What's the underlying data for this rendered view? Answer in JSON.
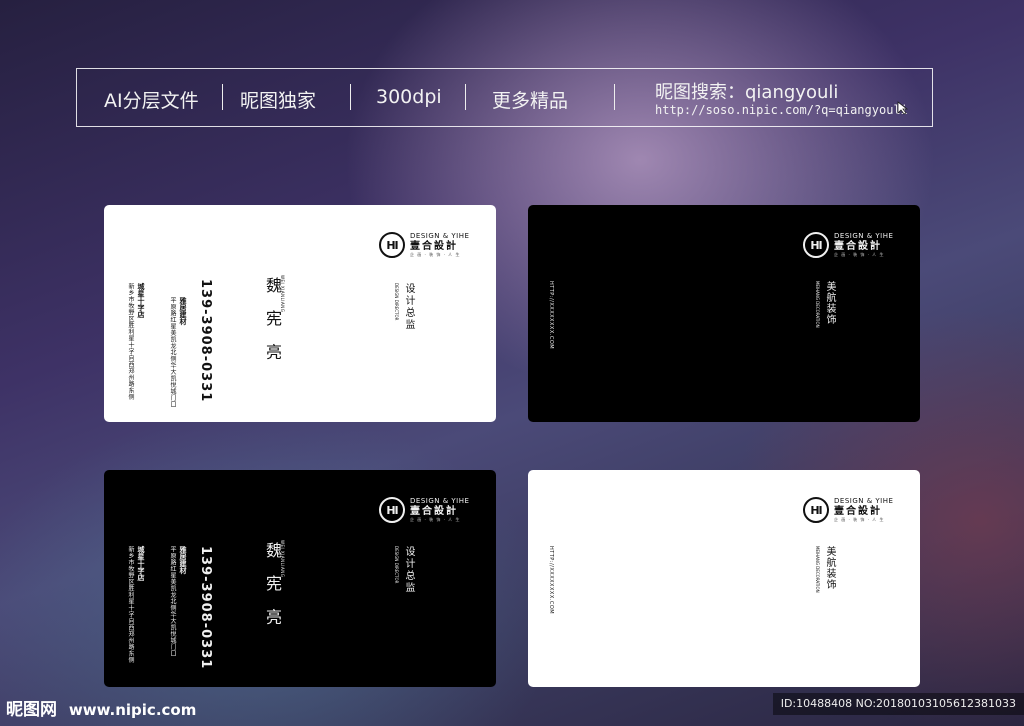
{
  "banner": {
    "items": [
      "AI分层文件",
      "昵图独家",
      "300dpi",
      "更多精品"
    ],
    "search_label": "昵图搜索：qiangyouli",
    "url": "http://soso.nipic.com/?q=qiangyouli"
  },
  "logo": {
    "mark": "HI",
    "en": "DESIGN & YIHE",
    "cn": "壹合設計",
    "sub": "企 画 · 装 饰 · 人 生"
  },
  "personal_card": {
    "name": "魏 宪 亮",
    "name_en": "WEI XIANLIANG",
    "title": "设计总监",
    "title_en": "DESIGN DIRECTOR",
    "phone": "139-3908-0331",
    "store1_name": "雅居建材",
    "store1_addr": "平原路红星美凯龙北侧华大凯悦城门口",
    "store2_name": "城星十字店",
    "store2_addr": "新乡市牧野区胜利星十字向西郑州路东侧"
  },
  "company_card": {
    "brand": "美航装饰",
    "brand_en": "MEIHANG DECORATION",
    "website": "HTTP://XXXXXXXX.COM"
  },
  "footer": {
    "brand": "昵图网",
    "site": "www.nipic.com",
    "id_text": "ID:10488408 NO:20180103105612381033"
  }
}
